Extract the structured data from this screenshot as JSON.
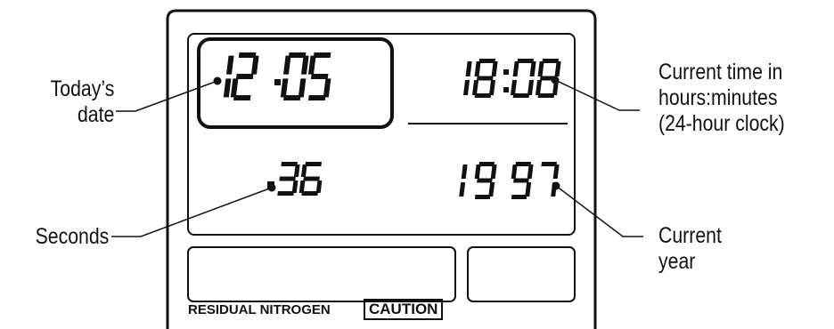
{
  "display": {
    "date": [
      "1",
      "2",
      "0",
      "5"
    ],
    "time": [
      "1",
      "8",
      "0",
      "8"
    ],
    "seconds": [
      "3",
      "6"
    ],
    "year": [
      "1",
      "9",
      "9",
      "7"
    ]
  },
  "labels": {
    "date": [
      "Today’s",
      "date"
    ],
    "seconds": "Seconds",
    "time": [
      "Current time in",
      "hours:minutes",
      "(24-hour clock)"
    ],
    "year": [
      "Current",
      "year"
    ]
  },
  "panel": {
    "residual_nitrogen": "RESIDUAL NITROGEN",
    "caution": "CAUTION"
  },
  "colors": {
    "ink": "#111111",
    "background": "#ffffff"
  }
}
